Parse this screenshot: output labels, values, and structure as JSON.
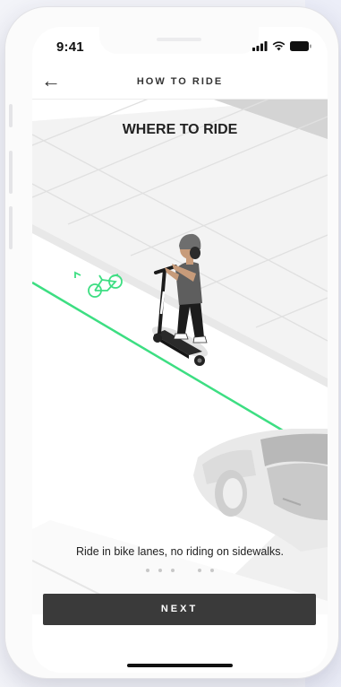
{
  "status": {
    "time": "9:41"
  },
  "header": {
    "title": "HOW TO RIDE",
    "back_icon": "arrow-left-icon"
  },
  "illustration": {
    "title": "WHERE TO RIDE",
    "lane_color": "#3dde82"
  },
  "caption": "Ride in bike lanes, no riding on sidewalks.",
  "pagination": {
    "pages": 5,
    "active": 3
  },
  "next_button": {
    "label": "NEXT"
  }
}
